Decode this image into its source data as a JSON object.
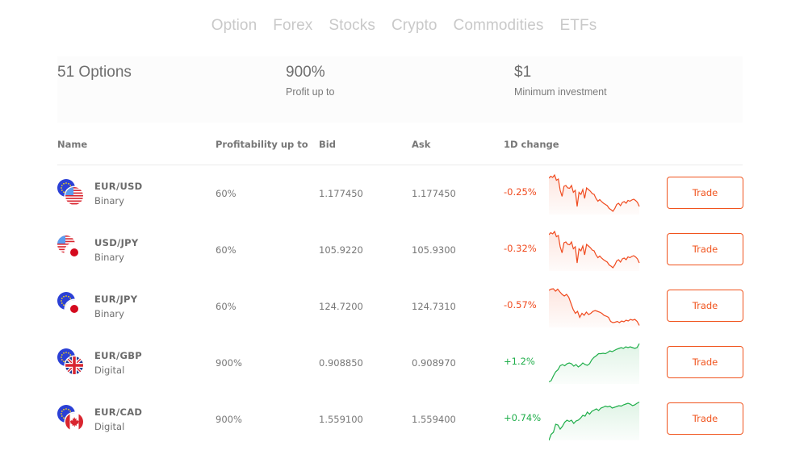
{
  "tabs": [
    "Option",
    "Forex",
    "Stocks",
    "Crypto",
    "Commodities",
    "ETFs"
  ],
  "summary": {
    "options": {
      "value": "51 Options",
      "label": ""
    },
    "profit": {
      "value": "900%",
      "label": "Profit up to"
    },
    "minimum": {
      "value": "$1",
      "label": "Minimum investment"
    }
  },
  "table": {
    "headers": {
      "name": "Name",
      "profitability": "Profitability up to",
      "bid": "Bid",
      "ask": "Ask",
      "change": "1D change"
    },
    "rows": [
      {
        "pair": "EUR/USD",
        "type": "Binary",
        "flags": [
          "eu-flag",
          "us-flag"
        ],
        "profitability": "60%",
        "bid": "1.177450",
        "ask": "1.177450",
        "change": "-0.25%",
        "direction": "down",
        "trade_label": "Trade",
        "sparkline": [
          0.9,
          0.95,
          0.92,
          0.98,
          0.85,
          0.88,
          0.6,
          0.45,
          0.7,
          0.72,
          0.66,
          0.65,
          0.72,
          0.55,
          0.6,
          0.2,
          0.55,
          0.5,
          0.62,
          0.4,
          0.66,
          0.62,
          0.58,
          0.52,
          0.5,
          0.4,
          0.33,
          0.37,
          0.32,
          0.28,
          0.25,
          0.22,
          0.15,
          0.12,
          0.08,
          0.15,
          0.25,
          0.28,
          0.22,
          0.3,
          0.32,
          0.28,
          0.35,
          0.33,
          0.36,
          0.38,
          0.35,
          0.3,
          0.2
        ]
      },
      {
        "pair": "USD/JPY",
        "type": "Binary",
        "flags": [
          "us-flag",
          "jp-flag"
        ],
        "profitability": "60%",
        "bid": "105.9220",
        "ask": "105.9300",
        "change": "-0.32%",
        "direction": "down",
        "trade_label": "Trade",
        "sparkline": [
          0.9,
          0.95,
          0.92,
          0.98,
          0.85,
          0.88,
          0.6,
          0.45,
          0.7,
          0.72,
          0.66,
          0.65,
          0.72,
          0.55,
          0.6,
          0.2,
          0.55,
          0.5,
          0.62,
          0.4,
          0.66,
          0.62,
          0.58,
          0.52,
          0.5,
          0.4,
          0.33,
          0.37,
          0.32,
          0.28,
          0.25,
          0.22,
          0.15,
          0.12,
          0.08,
          0.15,
          0.25,
          0.28,
          0.22,
          0.3,
          0.32,
          0.28,
          0.35,
          0.33,
          0.36,
          0.38,
          0.35,
          0.3,
          0.2
        ]
      },
      {
        "pair": "EUR/JPY",
        "type": "Binary",
        "flags": [
          "eu-flag",
          "jp-flag"
        ],
        "profitability": "60%",
        "bid": "124.7200",
        "ask": "124.7310",
        "change": "-0.57%",
        "direction": "down",
        "trade_label": "Trade",
        "sparkline": [
          0.92,
          0.95,
          0.96,
          0.9,
          0.95,
          0.88,
          0.82,
          0.78,
          0.82,
          0.75,
          0.6,
          0.45,
          0.35,
          0.4,
          0.25,
          0.35,
          0.3,
          0.38,
          0.32,
          0.35,
          0.4,
          0.42,
          0.4,
          0.38,
          0.35,
          0.3,
          0.28,
          0.25,
          0.15,
          0.12,
          0.13,
          0.15,
          0.12,
          0.16,
          0.14,
          0.18,
          0.16,
          0.2,
          0.18,
          0.2,
          0.15,
          0.05
        ]
      },
      {
        "pair": "EUR/GBP",
        "type": "Digital",
        "flags": [
          "eu-flag",
          "gb-flag"
        ],
        "profitability": "900%",
        "bid": "0.908850",
        "ask": "0.908970",
        "change": "+1.2%",
        "direction": "up",
        "trade_label": "Trade",
        "sparkline": [
          0.05,
          0.08,
          0.2,
          0.3,
          0.35,
          0.45,
          0.48,
          0.45,
          0.5,
          0.52,
          0.5,
          0.44,
          0.48,
          0.42,
          0.46,
          0.52,
          0.48,
          0.46,
          0.5,
          0.6,
          0.66,
          0.7,
          0.75,
          0.75,
          0.76,
          0.75,
          0.78,
          0.82,
          0.8,
          0.83,
          0.86,
          0.88,
          0.9,
          0.88,
          0.92,
          0.9,
          0.92,
          0.9,
          0.88,
          0.9,
          1.0
        ]
      },
      {
        "pair": "EUR/CAD",
        "type": "Digital",
        "flags": [
          "eu-flag",
          "ca-flag"
        ],
        "profitability": "900%",
        "bid": "1.559100",
        "ask": "1.559400",
        "change": "+0.74%",
        "direction": "up",
        "trade_label": "Trade",
        "sparkline": [
          0.0,
          0.15,
          0.2,
          0.4,
          0.38,
          0.28,
          0.35,
          0.45,
          0.5,
          0.47,
          0.5,
          0.42,
          0.48,
          0.5,
          0.55,
          0.62,
          0.6,
          0.7,
          0.65,
          0.72,
          0.75,
          0.78,
          0.74,
          0.8,
          0.82,
          0.85,
          0.83,
          0.85,
          0.8,
          0.82,
          0.84,
          0.86,
          0.85,
          0.88,
          0.9,
          0.92,
          0.9,
          0.86,
          0.88,
          0.92,
          0.95
        ]
      }
    ]
  },
  "colors": {
    "accent": "#f0541e",
    "negative": "#f04a1e",
    "positive": "#1fae4a",
    "tab_text": "#c9c9c9"
  }
}
